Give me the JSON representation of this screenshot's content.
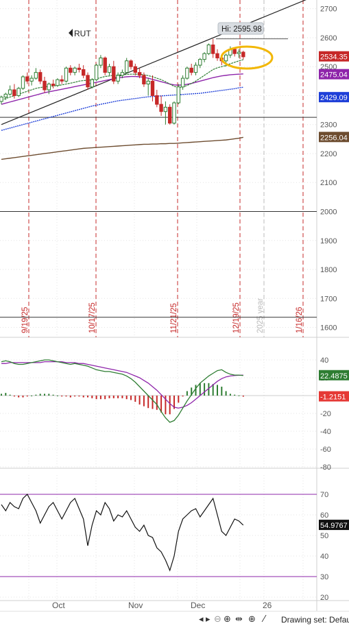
{
  "chart_data": [
    {
      "panel": "price",
      "type": "candlestick",
      "symbol": "RUT",
      "ylim": [
        1580,
        2730
      ],
      "y_ticks": [
        1600,
        1700,
        1800,
        1900,
        2000,
        2100,
        2200,
        2300,
        2400,
        2500,
        2600,
        2700
      ],
      "hi_label": "Hi: 2595.98",
      "price_labels": [
        {
          "text": "2534.35",
          "value": 2534.35,
          "color": "#c62828"
        },
        {
          "text": "2475.04",
          "value": 2475.04,
          "color": "#8e24aa"
        },
        {
          "text": "2429.09",
          "value": 2429.09,
          "color": "#1e3fd8"
        },
        {
          "text": "2256.04",
          "value": 2256.04,
          "color": "#6d4c2f"
        }
      ],
      "horizontal_lines": [
        2595.98,
        2325,
        2000,
        1635
      ],
      "vertical_markers": [
        {
          "label": "9/19/25",
          "color": "#c62828"
        },
        {
          "label": "10/17/25",
          "color": "#c62828"
        },
        {
          "label": "11/21/25",
          "color": "#c62828"
        },
        {
          "label": "12/19/25",
          "color": "#c62828"
        },
        {
          "label": "2025 year",
          "color": "#bbbbbb"
        },
        {
          "label": "1/16/26",
          "color": "#c62828"
        }
      ],
      "candles": [
        [
          2380,
          2400,
          2370,
          2395
        ],
        [
          2395,
          2410,
          2385,
          2405
        ],
        [
          2405,
          2435,
          2400,
          2420
        ],
        [
          2420,
          2440,
          2390,
          2400
        ],
        [
          2400,
          2430,
          2395,
          2425
        ],
        [
          2425,
          2470,
          2420,
          2465
        ],
        [
          2465,
          2480,
          2440,
          2450
        ],
        [
          2450,
          2470,
          2435,
          2460
        ],
        [
          2460,
          2495,
          2455,
          2480
        ],
        [
          2480,
          2490,
          2440,
          2450
        ],
        [
          2450,
          2465,
          2410,
          2420
        ],
        [
          2420,
          2445,
          2405,
          2440
        ],
        [
          2440,
          2455,
          2425,
          2435
        ],
        [
          2435,
          2460,
          2430,
          2455
        ],
        [
          2455,
          2470,
          2440,
          2450
        ],
        [
          2450,
          2500,
          2445,
          2495
        ],
        [
          2495,
          2505,
          2470,
          2480
        ],
        [
          2480,
          2500,
          2470,
          2495
        ],
        [
          2495,
          2510,
          2480,
          2490
        ],
        [
          2490,
          2505,
          2460,
          2470
        ],
        [
          2470,
          2480,
          2420,
          2430
        ],
        [
          2430,
          2460,
          2425,
          2455
        ],
        [
          2455,
          2510,
          2450,
          2505
        ],
        [
          2505,
          2540,
          2495,
          2530
        ],
        [
          2530,
          2535,
          2470,
          2480
        ],
        [
          2480,
          2510,
          2470,
          2500
        ],
        [
          2500,
          2520,
          2440,
          2450
        ],
        [
          2450,
          2480,
          2440,
          2470
        ],
        [
          2470,
          2490,
          2460,
          2480
        ],
        [
          2480,
          2530,
          2475,
          2520
        ],
        [
          2520,
          2525,
          2490,
          2500
        ],
        [
          2500,
          2510,
          2470,
          2480
        ],
        [
          2480,
          2495,
          2460,
          2470
        ],
        [
          2470,
          2480,
          2430,
          2440
        ],
        [
          2440,
          2460,
          2400,
          2450
        ],
        [
          2450,
          2470,
          2380,
          2400
        ],
        [
          2400,
          2420,
          2360,
          2370
        ],
        [
          2370,
          2400,
          2330,
          2345
        ],
        [
          2345,
          2380,
          2300,
          2360
        ],
        [
          2360,
          2370,
          2300,
          2305
        ],
        [
          2305,
          2380,
          2300,
          2375
        ],
        [
          2375,
          2440,
          2370,
          2430
        ],
        [
          2430,
          2470,
          2420,
          2460
        ],
        [
          2460,
          2500,
          2455,
          2495
        ],
        [
          2495,
          2510,
          2470,
          2480
        ],
        [
          2480,
          2515,
          2470,
          2505
        ],
        [
          2505,
          2530,
          2495,
          2525
        ],
        [
          2525,
          2550,
          2515,
          2545
        ],
        [
          2545,
          2580,
          2540,
          2575
        ],
        [
          2575,
          2596,
          2530,
          2545
        ],
        [
          2545,
          2560,
          2520,
          2530
        ],
        [
          2530,
          2540,
          2505,
          2520
        ],
        [
          2520,
          2545,
          2500,
          2540
        ],
        [
          2540,
          2570,
          2530,
          2560
        ],
        [
          2560,
          2565,
          2535,
          2545
        ],
        [
          2545,
          2560,
          2530,
          2550
        ],
        [
          2550,
          2555,
          2525,
          2534
        ]
      ],
      "trendline": {
        "from": [
          0,
          2300
        ],
        "to": [
          72,
          2740
        ]
      },
      "ma_short": [
        2385,
        2390,
        2395,
        2400,
        2405,
        2410,
        2415,
        2420,
        2425,
        2428,
        2430,
        2432,
        2433,
        2435,
        2437,
        2440,
        2443,
        2446,
        2450,
        2452,
        2453,
        2455,
        2458,
        2462,
        2466,
        2468,
        2470,
        2471,
        2472,
        2473,
        2474,
        2474,
        2474,
        2472,
        2469,
        2465,
        2460,
        2455,
        2448,
        2440,
        2432,
        2428,
        2430,
        2435,
        2442,
        2450,
        2460,
        2470,
        2480,
        2490,
        2496,
        2500,
        2504,
        2510,
        2515,
        2520,
        2524
      ],
      "ma_mid": [
        2370,
        2374,
        2378,
        2382,
        2386,
        2390,
        2394,
        2398,
        2402,
        2406,
        2410,
        2413,
        2416,
        2419,
        2422,
        2425,
        2428,
        2431,
        2434,
        2437,
        2440,
        2443,
        2446,
        2449,
        2452,
        2455,
        2458,
        2461,
        2463,
        2465,
        2466,
        2466,
        2465,
        2463,
        2460,
        2456,
        2452,
        2448,
        2444,
        2440,
        2437,
        2436,
        2437,
        2439,
        2442,
        2446,
        2450,
        2454,
        2458,
        2462,
        2465,
        2468,
        2470,
        2472,
        2473,
        2474,
        2475
      ],
      "ma_long": [
        2280,
        2284,
        2288,
        2292,
        2296,
        2300,
        2304,
        2308,
        2312,
        2316,
        2320,
        2324,
        2328,
        2332,
        2336,
        2340,
        2344,
        2348,
        2352,
        2356,
        2360,
        2364,
        2367,
        2370,
        2373,
        2376,
        2379,
        2382,
        2384,
        2386,
        2388,
        2390,
        2392,
        2394,
        2396,
        2397,
        2398,
        2399,
        2400,
        2401,
        2402,
        2403,
        2404,
        2405,
        2406,
        2407,
        2408,
        2410,
        2412,
        2414,
        2416,
        2418,
        2420,
        2422,
        2424,
        2427,
        2429
      ],
      "ma_longest": [
        2180,
        2182,
        2184,
        2186,
        2188,
        2190,
        2192,
        2194,
        2196,
        2198,
        2200,
        2202,
        2204,
        2206,
        2208,
        2210,
        2212,
        2214,
        2216,
        2218,
        2219,
        2220,
        2221,
        2222,
        2223,
        2224,
        2225,
        2226,
        2227,
        2228,
        2229,
        2230,
        2231,
        2232,
        2232,
        2233,
        2233,
        2234,
        2234,
        2235,
        2235,
        2236,
        2237,
        2238,
        2239,
        2240,
        2241,
        2242,
        2243,
        2244,
        2245,
        2246,
        2247,
        2249,
        2251,
        2253,
        2256
      ]
    },
    {
      "panel": "macd",
      "type": "line+bar",
      "ylim": [
        -80,
        50
      ],
      "y_ticks": [
        40,
        20,
        0,
        -20,
        -40,
        -60,
        -80
      ],
      "value_labels": [
        {
          "text": "22.4875",
          "value": 22.4875,
          "color": "#2e7d32"
        },
        {
          "text": "-1.2151",
          "value": -1.2151,
          "color": "#e53935"
        }
      ],
      "macd": [
        38,
        39,
        38,
        36,
        35,
        35,
        36,
        37,
        38,
        39,
        40,
        40,
        39,
        38,
        37,
        36,
        35,
        36,
        35,
        34,
        33,
        31,
        29,
        28,
        27,
        27,
        26,
        25,
        24,
        22,
        19,
        15,
        10,
        5,
        0,
        -5,
        -10,
        -18,
        -25,
        -30,
        -28,
        -22,
        -14,
        -6,
        1,
        8,
        14,
        18,
        22,
        25,
        28,
        29,
        26,
        24,
        23,
        23,
        22.5
      ],
      "signal": [
        36,
        36,
        37,
        37,
        37,
        37,
        37,
        37,
        37,
        37,
        38,
        38,
        38,
        38,
        38,
        37,
        37,
        37,
        36,
        36,
        35,
        34,
        33,
        32,
        31,
        30,
        29,
        28,
        27,
        26,
        24,
        22,
        20,
        17,
        14,
        10,
        6,
        1,
        -4,
        -9,
        -13,
        -14,
        -13,
        -11,
        -8,
        -4,
        0,
        4,
        8,
        12,
        16,
        19,
        21,
        22,
        22.5,
        22.8,
        23
      ],
      "histogram": [
        2,
        3,
        1,
        -1,
        -2,
        -2,
        -1,
        0,
        1,
        2,
        2,
        2,
        1,
        0,
        -1,
        -1,
        -2,
        -1,
        -1,
        -2,
        -2,
        -3,
        -4,
        -4,
        -4,
        -3,
        -3,
        -3,
        -3,
        -4,
        -5,
        -7,
        -10,
        -12,
        -14,
        -15,
        -16,
        -19,
        -21,
        -21,
        -15,
        -8,
        -1,
        5,
        9,
        12,
        14,
        14,
        14,
        13,
        12,
        10,
        5,
        2,
        1,
        0.2,
        -1.2
      ]
    },
    {
      "panel": "rsi",
      "type": "line",
      "ylim": [
        20,
        75
      ],
      "y_ticks": [
        70,
        60,
        50,
        40,
        30,
        20
      ],
      "bands": [
        70,
        30
      ],
      "value_label": {
        "text": "54.9767",
        "value": 54.9767
      },
      "rsi": [
        65,
        62,
        66,
        64,
        63,
        68,
        70,
        66,
        62,
        56,
        60,
        64,
        66,
        62,
        58,
        62,
        66,
        68,
        63,
        58,
        45,
        55,
        62,
        60,
        66,
        63,
        57,
        60,
        59,
        62,
        58,
        54,
        52,
        55,
        50,
        49,
        44,
        42,
        38,
        33,
        40,
        52,
        58,
        60,
        62,
        63,
        59,
        62,
        65,
        68,
        60,
        52,
        50,
        54,
        58,
        57,
        55
      ]
    }
  ],
  "x_axis": {
    "tick_labels": [
      "Oct",
      "Nov",
      "Dec",
      "26"
    ]
  },
  "toolbar": {
    "drawing_set_label": "Drawing set: Default"
  }
}
